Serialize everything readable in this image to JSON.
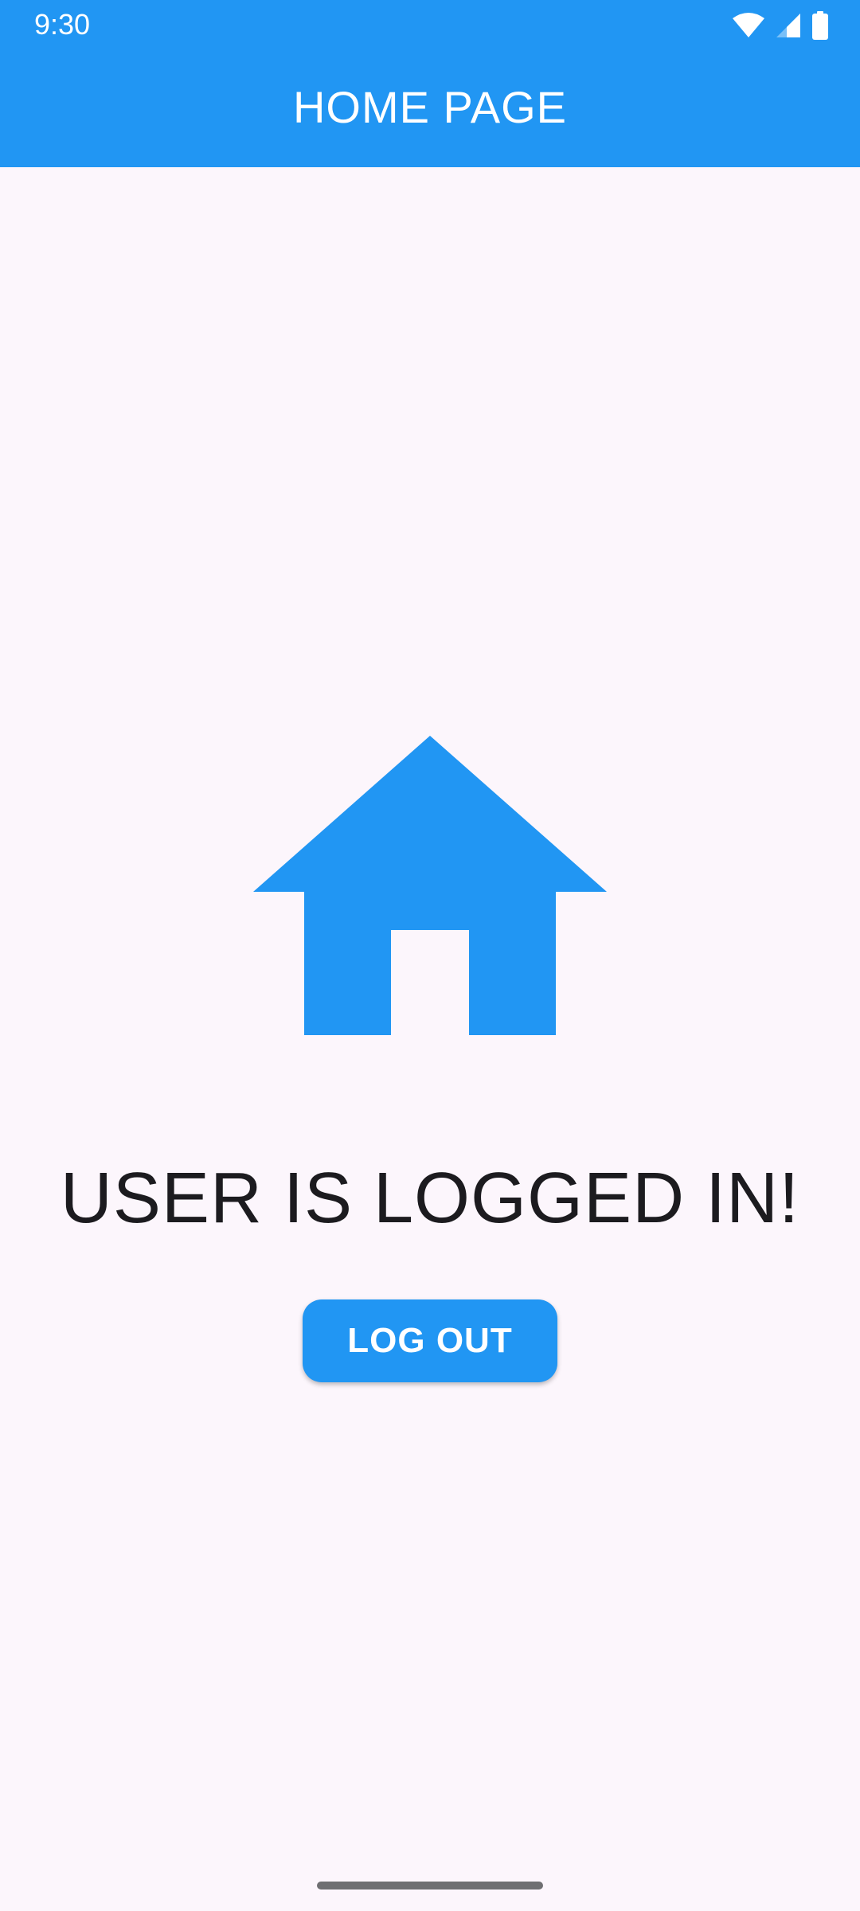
{
  "status_bar": {
    "time": "9:30",
    "icons": [
      "wifi-icon",
      "cellular-signal-icon",
      "battery-icon"
    ]
  },
  "app_bar": {
    "title": "HOME PAGE"
  },
  "main": {
    "icon": "home-icon",
    "message": "USER IS LOGGED IN!",
    "logout_label": "LOG OUT"
  },
  "colors": {
    "primary": "#2196f3",
    "background": "#fcf6fc",
    "text": "#1c1b1f",
    "on_primary": "#ffffff"
  }
}
